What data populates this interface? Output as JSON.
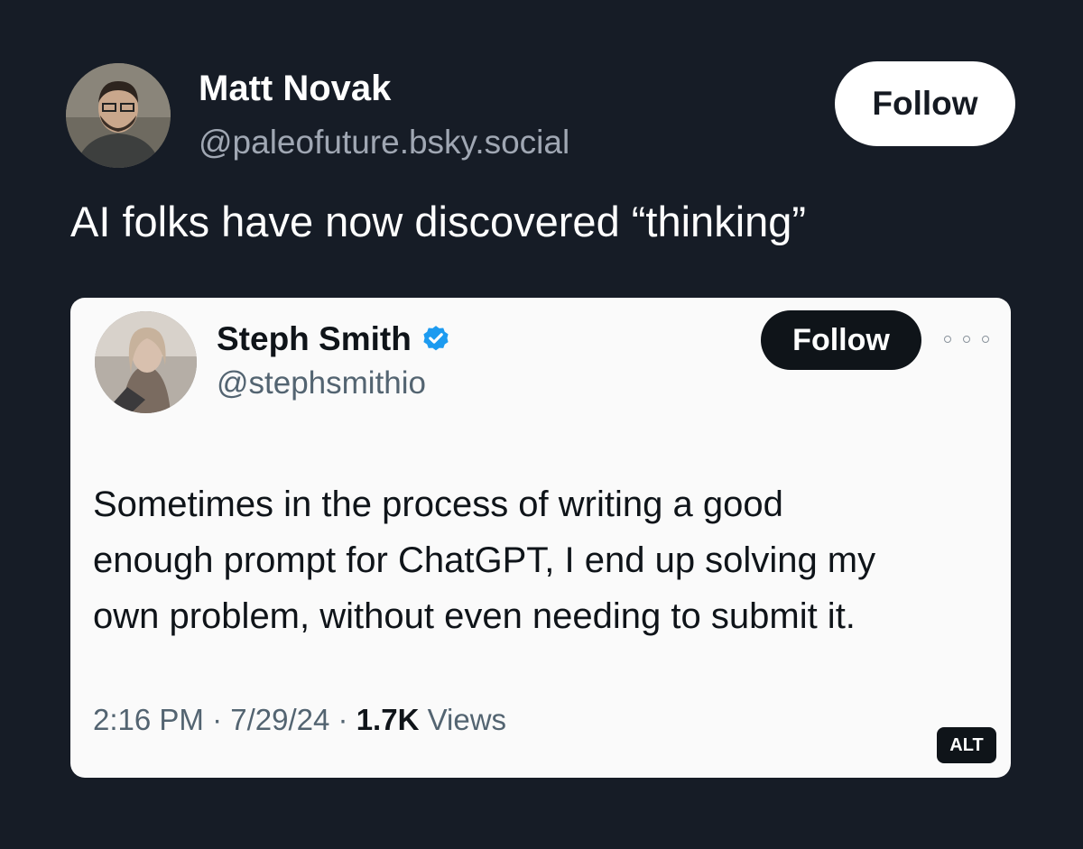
{
  "outer_post": {
    "author_name": "Matt Novak",
    "author_handle": "@paleofuture.bsky.social",
    "follow_label": "Follow",
    "text": "AI folks have now discovered “thinking”"
  },
  "embedded_post": {
    "author_name": "Steph Smith",
    "verified": true,
    "author_handle": "@stephsmithio",
    "follow_label": "Follow",
    "text_lines": [
      "Sometimes in the process of writing a good",
      "enough prompt for ChatGPT, I end up solving my",
      "own problem, without even needing to submit it."
    ],
    "time": "2:16 PM",
    "separator": "·",
    "date": "7/29/24",
    "views_count": "1.7K",
    "views_label": "Views",
    "alt_label": "ALT"
  },
  "colors": {
    "background": "#161c26",
    "card": "#fafafa",
    "verified_blue": "#1d9bf0"
  },
  "icons": {
    "verified": "verified-badge-icon",
    "more": "more-options-icon"
  }
}
